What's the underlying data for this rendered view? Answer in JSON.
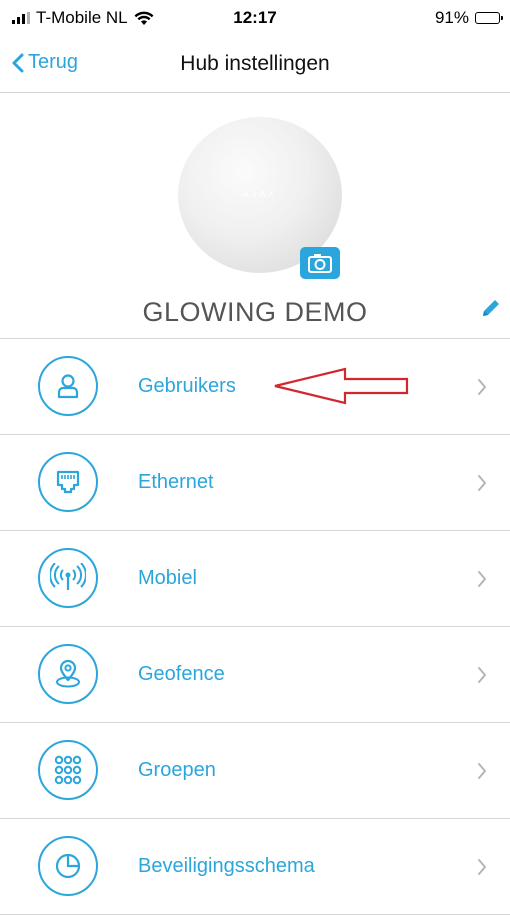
{
  "status_bar": {
    "carrier": "T-Mobile NL",
    "time": "12:17",
    "battery": "91%"
  },
  "nav": {
    "back_label": "Terug",
    "title": "Hub instellingen"
  },
  "hub": {
    "logo_text": "AJAX",
    "name": "GLOWING DEMO"
  },
  "settings": {
    "items": [
      {
        "label": "Gebruikers",
        "icon": "user-icon"
      },
      {
        "label": "Ethernet",
        "icon": "ethernet-port-icon"
      },
      {
        "label": "Mobiel",
        "icon": "antenna-icon"
      },
      {
        "label": "Geofence",
        "icon": "location-pin-icon"
      },
      {
        "label": "Groepen",
        "icon": "groups-grid-icon"
      },
      {
        "label": "Beveiligingsschema",
        "icon": "clock-icon"
      }
    ]
  },
  "colors": {
    "accent": "#2ba6dc",
    "annotation": "#d0282e"
  }
}
